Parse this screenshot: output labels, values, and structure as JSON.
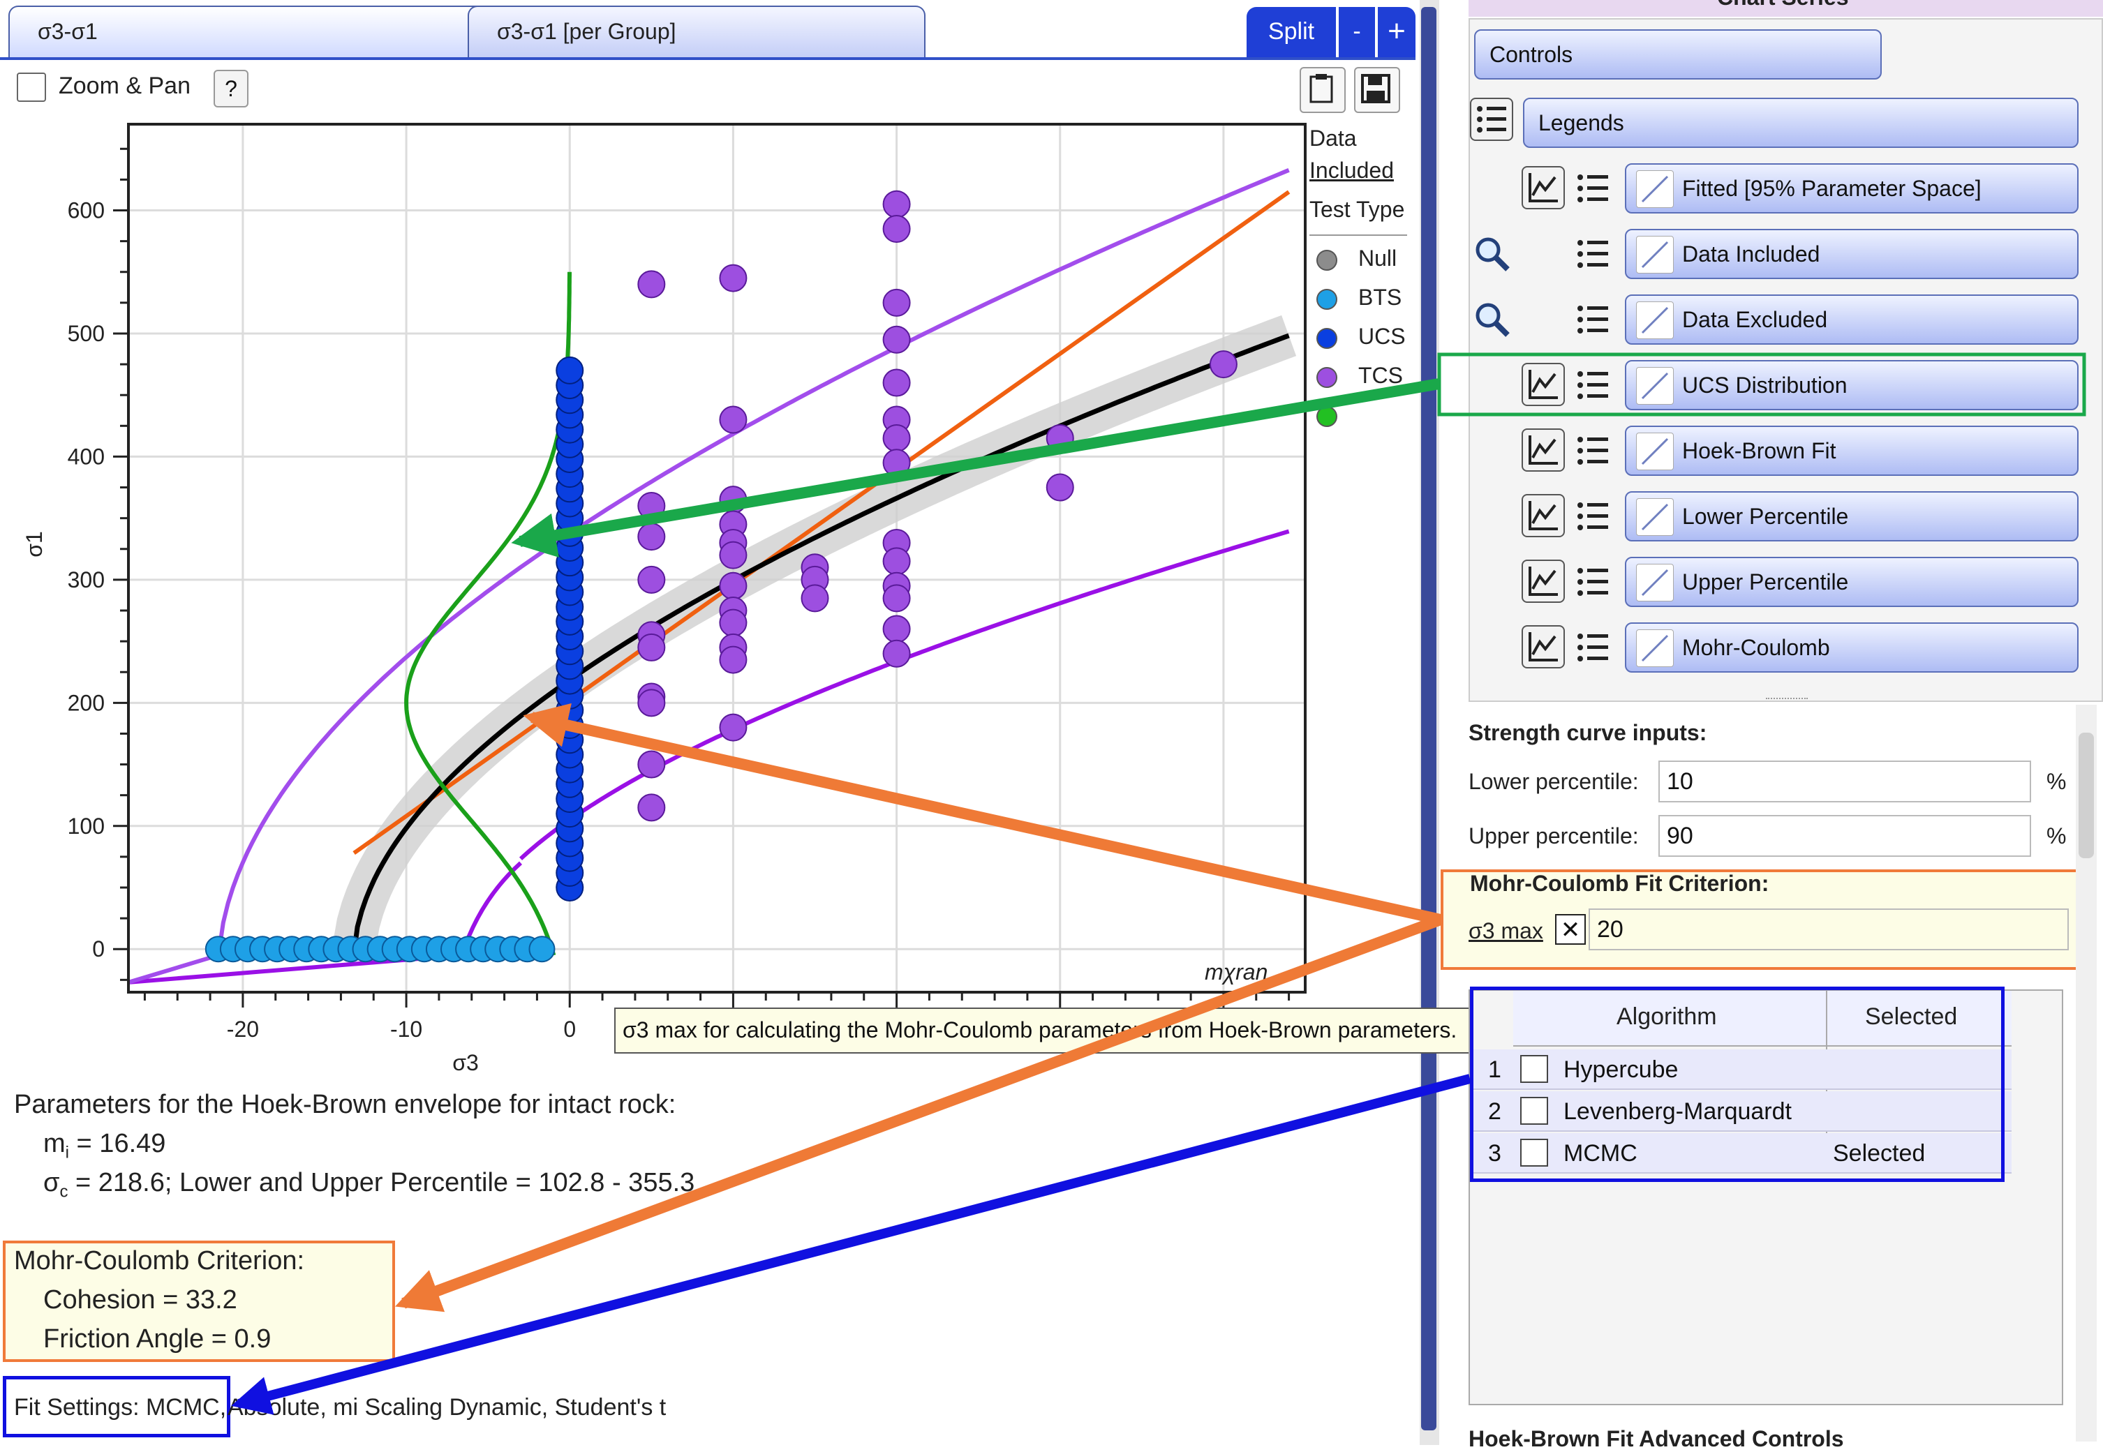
{
  "tabs": [
    {
      "label": "σ3-σ1"
    },
    {
      "label": "σ3-σ1 [per Group]"
    }
  ],
  "split_label": "Split",
  "minus_label": "-",
  "plus_label": "+",
  "zoom_pan_label": "Zoom & Pan",
  "help_label": "?",
  "legend": {
    "header1": "Data",
    "header2": "Included",
    "header3": "Test Type",
    "items": [
      {
        "label": "Null",
        "color": "#8c8c8c"
      },
      {
        "label": "BTS",
        "color": "#1ea0e6"
      },
      {
        "label": "UCS",
        "color": "#0a3fe0"
      },
      {
        "label": "TCS",
        "color": "#9d4fe0"
      },
      {
        "label": "",
        "color": "#22c022"
      }
    ]
  },
  "watermark": "mχran",
  "tooltip": "σ3 max for calculating the Mohr-Coulomb parameters from Hoek-Brown parameters.",
  "params": {
    "title": "Parameters for the Hoek-Brown envelope for intact rock:",
    "mi": "m",
    "mi_sub": "i",
    "mi_value": " = 16.49",
    "sc": "σ",
    "sc_sub": "c",
    "sc_value": " = 218.6; Lower and Upper Percentile = 102.8 - 355.3"
  },
  "mohr": {
    "title": "Mohr-Coulomb Criterion:",
    "cohesion": "Cohesion = 33.2",
    "friction": "Friction Angle = 0.9"
  },
  "fit_settings_box": "Fit Settings: MCMC,",
  "fit_settings_rest": " Absolute, mi Scaling Dynamic, Student's t",
  "panel": {
    "header": "Chart Series",
    "controls": "Controls",
    "legends": "Legends",
    "series": [
      "Fitted [95% Parameter Space]",
      "Data Included",
      "Data Excluded",
      "UCS Distribution",
      "Hoek-Brown Fit",
      "Lower Percentile",
      "Upper Percentile",
      "Mohr-Coulomb"
    ]
  },
  "inputs": {
    "title": "Strength curve inputs:",
    "lower_label": "Lower percentile:",
    "lower_value": "10",
    "upper_label": "Upper percentile:",
    "upper_value": "90",
    "pct": "%",
    "mc_title": "Mohr-Coulomb Fit Criterion:",
    "s3max_label": "σ3 max",
    "s3max_check": "✕",
    "s3max_value": "20"
  },
  "algo": {
    "col1": "Algorithm",
    "col2": "Selected",
    "rows": [
      {
        "n": "1",
        "name": "Hypercube",
        "sel": ""
      },
      {
        "n": "2",
        "name": "Levenberg-Marquardt",
        "sel": ""
      },
      {
        "n": "3",
        "name": "MCMC",
        "sel": "Selected"
      }
    ]
  },
  "bottom_cut": "Hoek-Brown Fit Advanced Controls",
  "chart_data": {
    "type": "scatter",
    "xlabel": "σ3",
    "ylabel": "σ1",
    "xlim": [
      -27,
      45
    ],
    "ylim": [
      -35,
      670
    ],
    "xticks": [
      -20,
      -10,
      0
    ],
    "yticks": [
      0,
      100,
      200,
      300,
      400,
      500,
      600
    ],
    "series": [
      {
        "name": "TCS",
        "color": "#9d4fe0",
        "points": [
          [
            5,
            540
          ],
          [
            5,
            360
          ],
          [
            5,
            335
          ],
          [
            5,
            300
          ],
          [
            5,
            255
          ],
          [
            5,
            245
          ],
          [
            5,
            205
          ],
          [
            5,
            200
          ],
          [
            5,
            150
          ],
          [
            5,
            115
          ],
          [
            10,
            545
          ],
          [
            10,
            430
          ],
          [
            10,
            365
          ],
          [
            10,
            345
          ],
          [
            10,
            330
          ],
          [
            10,
            320
          ],
          [
            10,
            295
          ],
          [
            10,
            275
          ],
          [
            10,
            265
          ],
          [
            10,
            245
          ],
          [
            10,
            235
          ],
          [
            10,
            180
          ],
          [
            15,
            310
          ],
          [
            15,
            300
          ],
          [
            15,
            285
          ],
          [
            20,
            605
          ],
          [
            20,
            585
          ],
          [
            20,
            525
          ],
          [
            20,
            495
          ],
          [
            20,
            460
          ],
          [
            20,
            430
          ],
          [
            20,
            415
          ],
          [
            20,
            395
          ],
          [
            20,
            330
          ],
          [
            20,
            315
          ],
          [
            20,
            295
          ],
          [
            20,
            285
          ],
          [
            20,
            260
          ],
          [
            20,
            240
          ],
          [
            30,
            415
          ],
          [
            30,
            375
          ],
          [
            40,
            475
          ]
        ]
      },
      {
        "name": "UCS",
        "color": "#0a3fe0",
        "x": 0,
        "y_range": [
          50,
          478
        ]
      },
      {
        "name": "BTS",
        "color": "#1ea0e6",
        "y": 0,
        "x_range": [
          -21.5,
          -1
        ]
      }
    ],
    "curves": [
      {
        "name": "Hoek-Brown Fit",
        "color": "#000000"
      },
      {
        "name": "Upper Percentile",
        "color": "#a24dec"
      },
      {
        "name": "Lower Percentile",
        "color": "#9a10e6"
      },
      {
        "name": "Mohr-Coulomb",
        "color": "#f06010"
      },
      {
        "name": "UCS Distribution",
        "color": "#1aa01a"
      }
    ]
  }
}
